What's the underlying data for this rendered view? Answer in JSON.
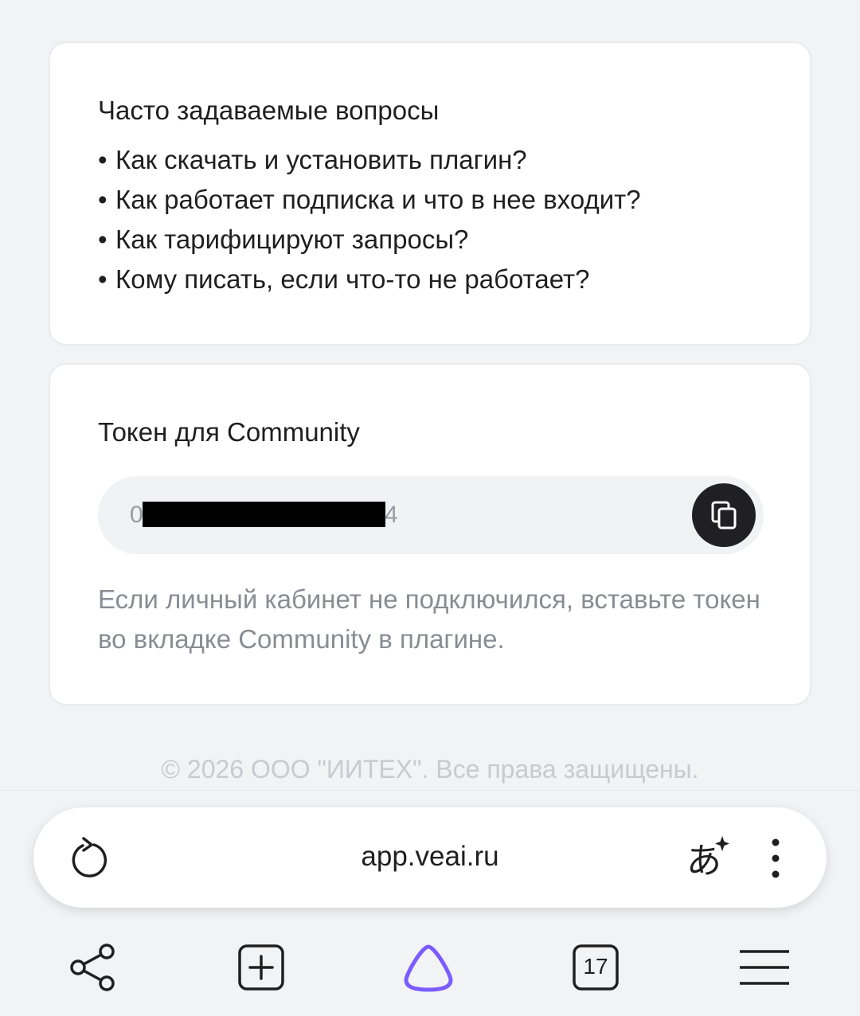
{
  "faq": {
    "title": "Часто задаваемые вопросы",
    "bullet": "•",
    "items": [
      "Как скачать и установить плагин?",
      "Как работает подписка и что в нее входит?",
      "Как тарифицируют запросы?",
      "Кому писать, если что-то не работает?"
    ]
  },
  "token": {
    "title": "Токен для Community",
    "value_first": "0",
    "value_last": "4",
    "hint": "Если личный кабинет не подключился, вставьте токен во вкладке Community в плагине."
  },
  "footer": {
    "copyright": "© 2026 ООО \"ИИТЕХ\". Все права защищены."
  },
  "browser": {
    "url": "app.veai.ru",
    "tabs_count": "17",
    "accent_color": "#7b5cff"
  },
  "icons": {
    "reload": "reload-icon",
    "translate": "translate-icon",
    "more": "more-vertical-icon",
    "copy": "copy-icon",
    "share": "share-icon",
    "new_tab": "new-tab-icon",
    "alice": "alice-icon",
    "tabs": "tabs-icon",
    "menu": "menu-icon"
  }
}
